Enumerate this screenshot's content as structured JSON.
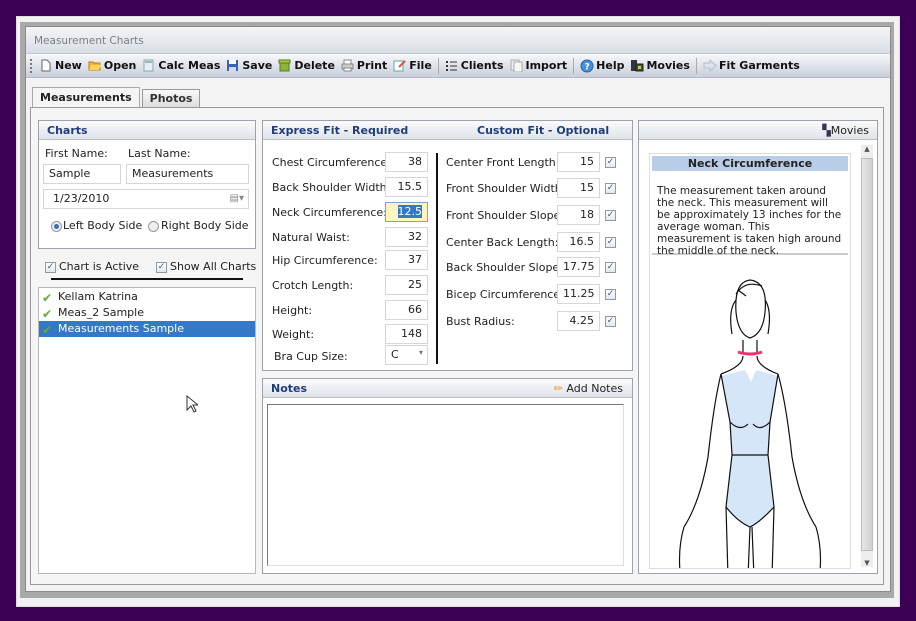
{
  "window": {
    "title": "Measurement Charts"
  },
  "toolbar": {
    "items": [
      {
        "label": "New",
        "icon": "new-document-icon"
      },
      {
        "label": "Open",
        "icon": "open-folder-icon"
      },
      {
        "label": "Calc Meas",
        "icon": "calculator-icon"
      },
      {
        "label": "Save",
        "icon": "save-disk-icon"
      },
      {
        "label": "Delete",
        "icon": "delete-bin-icon"
      },
      {
        "label": "Print",
        "icon": "printer-icon"
      },
      {
        "label": "File",
        "icon": "file-edit-icon"
      },
      {
        "label": "Clients",
        "icon": "list-icon"
      },
      {
        "label": "Import",
        "icon": "import-icon"
      },
      {
        "label": "Help",
        "icon": "help-icon"
      },
      {
        "label": "Movies",
        "icon": "movies-icon"
      },
      {
        "label": "Fit Garments",
        "icon": "arrow-right-icon"
      }
    ]
  },
  "tabs": [
    {
      "label": "Measurements",
      "active": true
    },
    {
      "label": "Photos",
      "active": false
    }
  ],
  "charts": {
    "title": "Charts",
    "first_name_label": "First Name:",
    "last_name_label": "Last Name:",
    "first_name": "Sample",
    "last_name": "Measurements",
    "date": "1/23/2010",
    "left_side_label": "Left Body Side",
    "right_side_label": "Right Body Side",
    "selected_side": "left",
    "chart_active_label": "Chart is Active",
    "chart_active": true,
    "show_all_label": "Show All Charts",
    "show_all": true,
    "list": [
      {
        "name": "Kellam Katrina",
        "selected": false
      },
      {
        "name": "Meas_2 Sample",
        "selected": false
      },
      {
        "name": "Measurements Sample",
        "selected": true
      }
    ]
  },
  "express_fit": {
    "title": "Express Fit - Required",
    "fields": [
      {
        "label": "Chest Circumference:",
        "value": "38"
      },
      {
        "label": "Back Shoulder Width:",
        "value": "15.5"
      },
      {
        "label": "Neck Circumference:",
        "value": "12.5",
        "focused": true
      },
      {
        "label": "Natural Waist:",
        "value": "32"
      },
      {
        "label": "Hip Circumference:",
        "value": "37"
      },
      {
        "label": "Crotch Length:",
        "value": "25"
      },
      {
        "label": "Height:",
        "value": "66"
      },
      {
        "label": "Weight:",
        "value": "148"
      }
    ],
    "bra_cup_label": "Bra Cup Size:",
    "bra_cup_value": "C"
  },
  "custom_fit": {
    "title": "Custom Fit - Optional",
    "fields": [
      {
        "label": "Center Front Length:",
        "value": "15",
        "checked": true
      },
      {
        "label": "Front Shoulder Width:",
        "value": "15",
        "checked": true
      },
      {
        "label": "Front Shoulder Slope:",
        "value": "18",
        "checked": true
      },
      {
        "label": "Center Back Length:",
        "value": "16.5",
        "checked": true
      },
      {
        "label": "Back Shoulder Slope:",
        "value": "17.75",
        "checked": true
      },
      {
        "label": "Bicep Circumference:",
        "value": "11.25",
        "checked": true
      },
      {
        "label": "Bust Radius:",
        "value": "4.25",
        "checked": true
      }
    ]
  },
  "notes": {
    "title": "Notes",
    "add_label": "Add Notes",
    "text": ""
  },
  "info": {
    "movies_label": "Movies",
    "heading": "Neck Circumference",
    "description": "The measurement taken around the neck. This measurement will be approximately 13 inches for the average woman. This measurement is taken high around the middle of the neck."
  },
  "colors": {
    "accent": "#1f3d7a",
    "selection": "#3478c8",
    "neck_marker": "#e8336f",
    "body_fill": "#d4e6f7"
  }
}
